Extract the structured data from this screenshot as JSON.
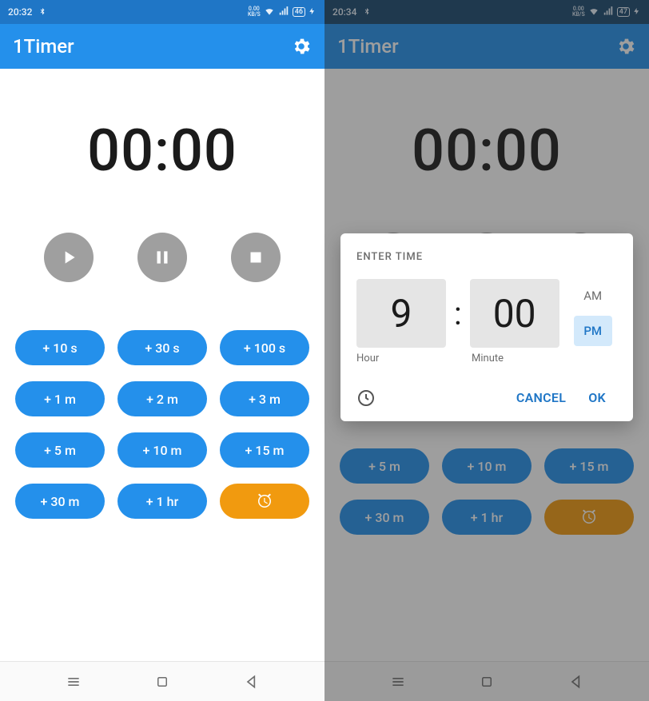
{
  "left": {
    "status": {
      "time": "20:32",
      "speed_top": "0.00",
      "speed_unit": "KB/S",
      "battery": "46"
    },
    "app_title": "1Timer",
    "timer": "00:00",
    "presets": [
      "+ 10 s",
      "+ 30 s",
      "+ 100 s",
      "+ 1 m",
      "+ 2 m",
      "+ 3 m",
      "+ 5 m",
      "+ 10 m",
      "+ 15 m",
      "+ 30 m",
      "+ 1 hr"
    ]
  },
  "right": {
    "status": {
      "time": "20:34",
      "speed_top": "0.00",
      "speed_unit": "KB/S",
      "battery": "47"
    },
    "app_title": "1Timer",
    "timer": "00:00",
    "presets": [
      "+ 5 m",
      "+ 10 m",
      "+ 15 m",
      "+ 30 m",
      "+ 1 hr"
    ],
    "dialog": {
      "title": "ENTER TIME",
      "hour": "9",
      "minute": "00",
      "hour_label": "Hour",
      "minute_label": "Minute",
      "am": "AM",
      "pm": "PM",
      "selected_ampm": "PM",
      "cancel": "CANCEL",
      "ok": "OK"
    }
  }
}
